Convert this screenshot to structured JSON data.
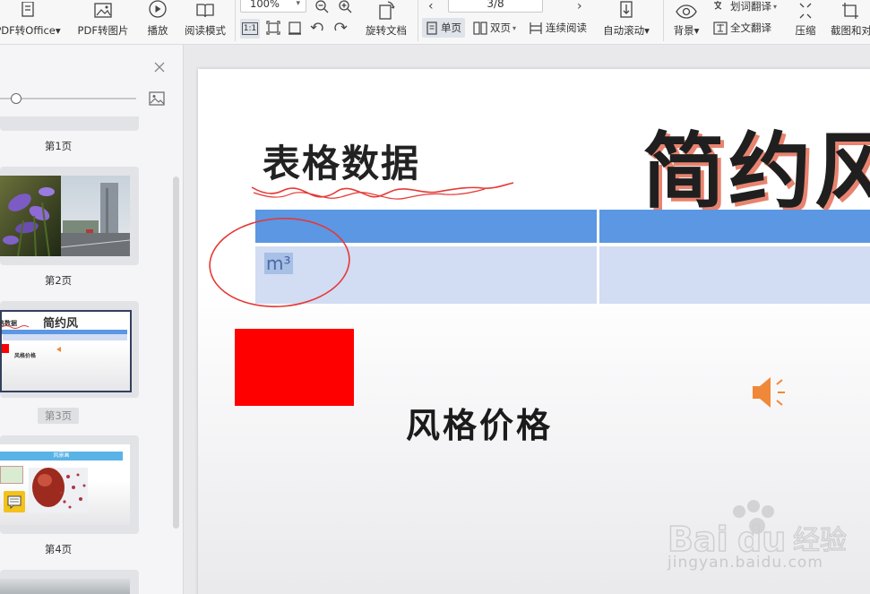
{
  "toolbar": {
    "pdf_to_office": "PDF转Office",
    "pdf_to_image": "PDF转图片",
    "play": "播放",
    "read_mode": "阅读模式",
    "zoom_value": "100%",
    "one_to_one": "1:1",
    "rotate_doc": "旋转文档",
    "page_indicator": "3/8",
    "single_page": "单页",
    "double_page": "双页",
    "continuous": "连续阅读",
    "auto_scroll": "自动滚动",
    "background": "背景",
    "word_translate": "划词翻译",
    "full_translate": "全文翻译",
    "compress": "压缩",
    "screenshot_compare": "截图和对"
  },
  "sidebar": {
    "pages": [
      {
        "label": "第1页"
      },
      {
        "label": "第2页"
      },
      {
        "label": "第3页",
        "selected": true
      },
      {
        "label": "第4页"
      }
    ],
    "thumb3": {
      "title": "简约风",
      "heading": "格数据",
      "text": "风格价格"
    },
    "thumb4": {
      "banner": "风景画"
    }
  },
  "slide": {
    "title": "表格数据",
    "big_title": "简约风",
    "cell_text": "m³",
    "subtitle": "风格价格"
  },
  "colors": {
    "table_header": "#5b97e3",
    "table_cell": "#d2dcf3",
    "red_block": "#ff0000",
    "speaker": "#f0883a",
    "annotation": "#e53935"
  },
  "watermark": {
    "brand": "Bai du 经验",
    "url": "jingyan.baidu.com"
  }
}
